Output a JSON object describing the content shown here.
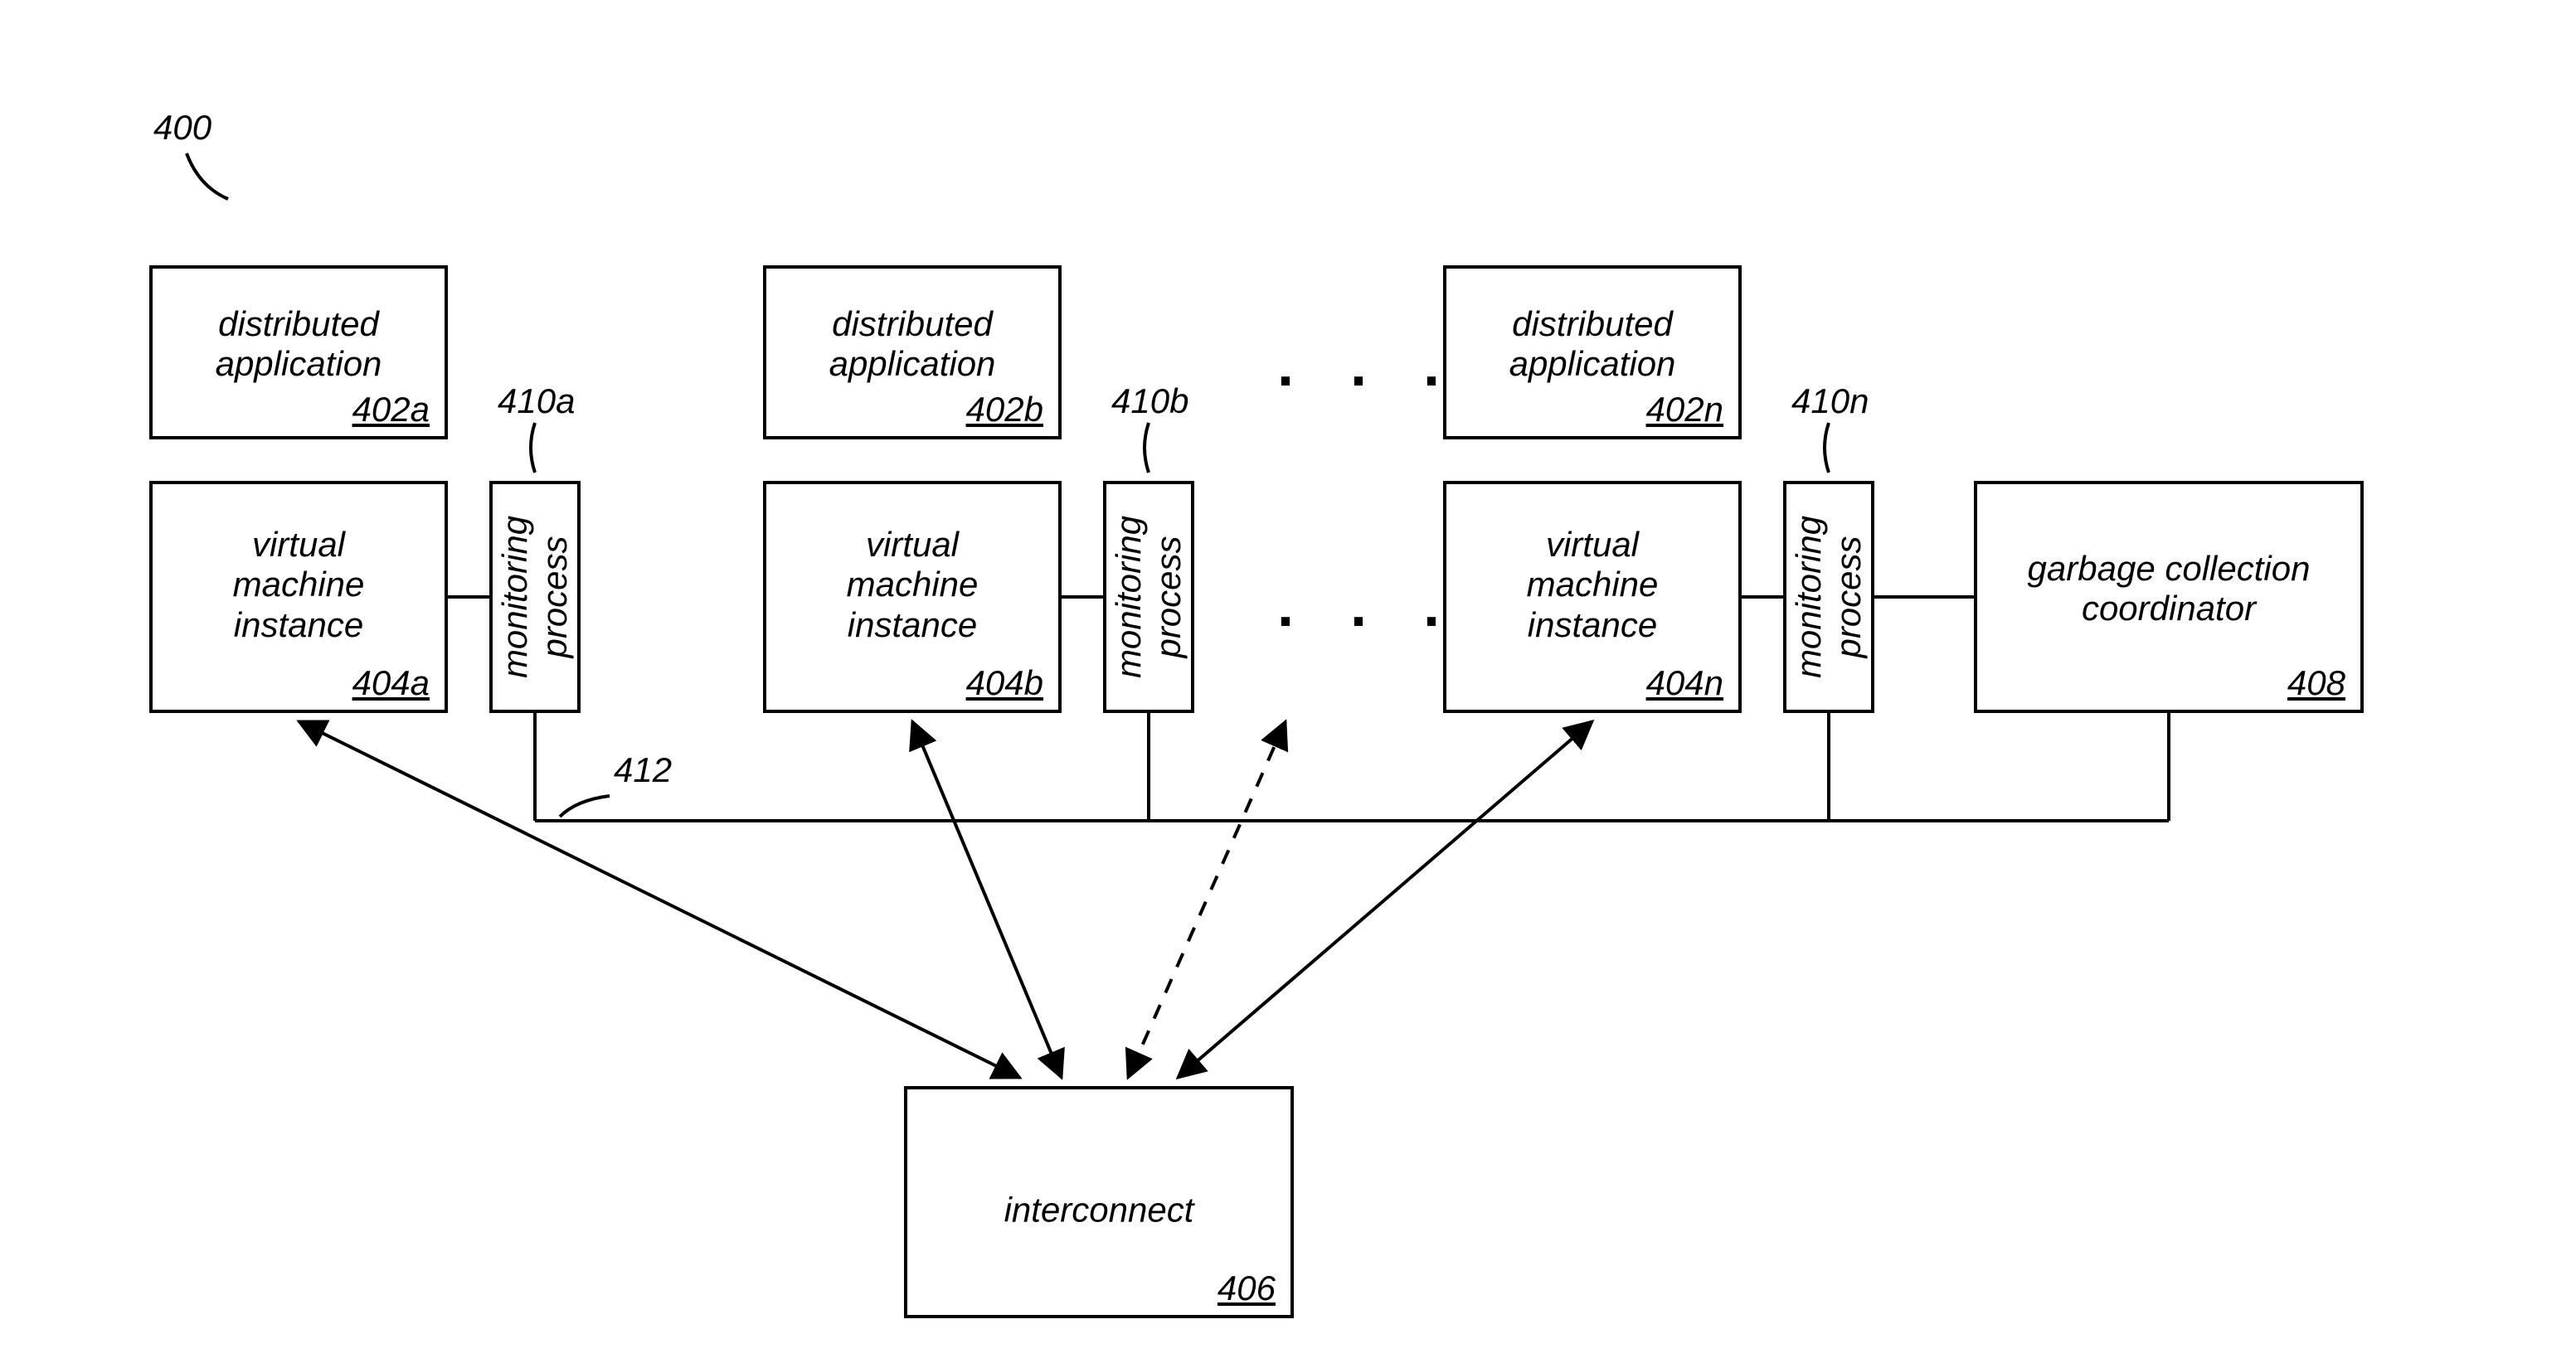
{
  "figure_ref": "400",
  "apps": {
    "a": {
      "label": "distributed\napplication",
      "ref": "402a"
    },
    "b": {
      "label": "distributed\napplication",
      "ref": "402b"
    },
    "n": {
      "label": "distributed\napplication",
      "ref": "402n"
    }
  },
  "vms": {
    "a": {
      "label": "virtual\nmachine\ninstance",
      "ref": "404a"
    },
    "b": {
      "label": "virtual\nmachine\ninstance",
      "ref": "404b"
    },
    "n": {
      "label": "virtual\nmachine\ninstance",
      "ref": "404n"
    }
  },
  "monitors": {
    "a": {
      "label": "monitoring\nprocess",
      "float": "410a"
    },
    "b": {
      "label": "monitoring\nprocess",
      "float": "410b"
    },
    "n": {
      "label": "monitoring\nprocess",
      "float": "410n"
    }
  },
  "coordinator": {
    "label": "garbage collection\ncoordinator",
    "ref": "408"
  },
  "interconnect": {
    "label": "interconnect",
    "ref": "406"
  },
  "bus_ref": "412",
  "ellipsis": ". . ."
}
